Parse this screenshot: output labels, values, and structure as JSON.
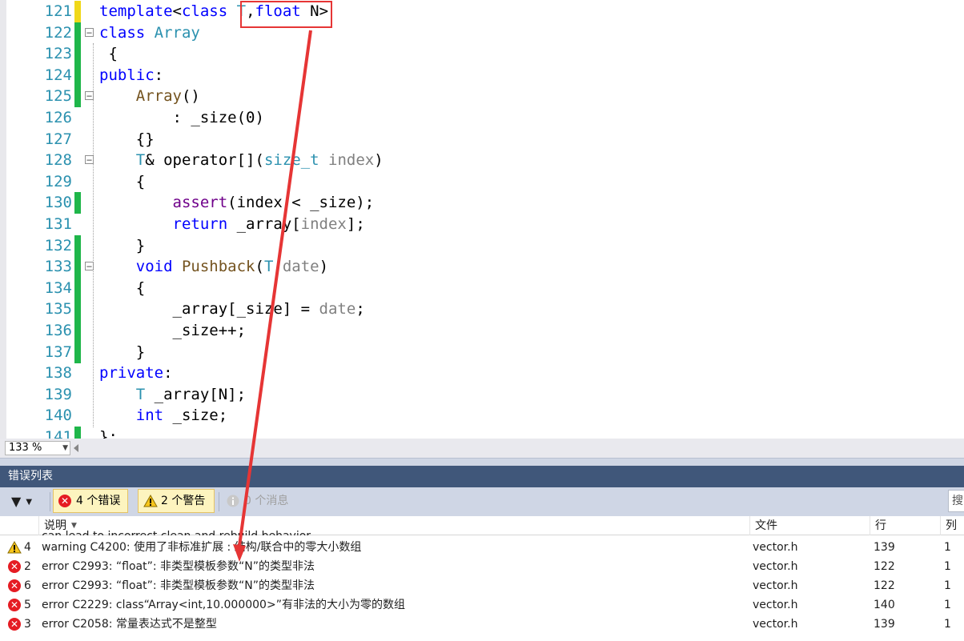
{
  "editor": {
    "lines": [
      {
        "num": "121",
        "mark": "yellow",
        "fold": "",
        "indent": 0,
        "tokens": [
          [
            "kw",
            "template"
          ],
          [
            "plain",
            "<"
          ],
          [
            "kw",
            "class"
          ],
          [
            "plain",
            " "
          ],
          [
            "ty",
            "T"
          ],
          [
            "plain",
            ","
          ],
          [
            "kw",
            "float"
          ],
          [
            "plain",
            " N>"
          ]
        ]
      },
      {
        "num": "122",
        "mark": "green",
        "fold": "-",
        "indent": 0,
        "tokens": [
          [
            "kw",
            "class"
          ],
          [
            "plain",
            " "
          ],
          [
            "ty",
            "Array"
          ]
        ]
      },
      {
        "num": "123",
        "mark": "green",
        "fold": "",
        "indent": 0,
        "tokens": [
          [
            "plain",
            " {"
          ]
        ]
      },
      {
        "num": "124",
        "mark": "green",
        "fold": "",
        "indent": 0,
        "tokens": [
          [
            "kw",
            "public"
          ],
          [
            "plain",
            ":"
          ]
        ]
      },
      {
        "num": "125",
        "mark": "green",
        "fold": "-",
        "indent": 0,
        "tokens": [
          [
            "plain",
            "    "
          ],
          [
            "fn",
            "Array"
          ],
          [
            "plain",
            "()"
          ]
        ]
      },
      {
        "num": "126",
        "mark": "",
        "fold": "",
        "indent": 0,
        "tokens": [
          [
            "plain",
            "        : _size(0)"
          ]
        ]
      },
      {
        "num": "127",
        "mark": "",
        "fold": "",
        "indent": 0,
        "tokens": [
          [
            "plain",
            "    {}"
          ]
        ]
      },
      {
        "num": "128",
        "mark": "",
        "fold": "-",
        "indent": 0,
        "tokens": [
          [
            "plain",
            "    "
          ],
          [
            "ty",
            "T"
          ],
          [
            "plain",
            "& operator[]("
          ],
          [
            "ty",
            "size_t"
          ],
          [
            "plain",
            " "
          ],
          [
            "par",
            "index"
          ],
          [
            "plain",
            ")"
          ]
        ]
      },
      {
        "num": "129",
        "mark": "",
        "fold": "",
        "indent": 0,
        "tokens": [
          [
            "plain",
            "    {"
          ]
        ]
      },
      {
        "num": "130",
        "mark": "green",
        "fold": "",
        "indent": 0,
        "tokens": [
          [
            "plain",
            "        "
          ],
          [
            "mac",
            "assert"
          ],
          [
            "plain",
            "(index < _size);"
          ]
        ]
      },
      {
        "num": "131",
        "mark": "",
        "fold": "",
        "indent": 0,
        "tokens": [
          [
            "plain",
            "        "
          ],
          [
            "kw",
            "return"
          ],
          [
            "plain",
            " _array["
          ],
          [
            "par",
            "index"
          ],
          [
            "plain",
            "];"
          ]
        ]
      },
      {
        "num": "132",
        "mark": "green",
        "fold": "",
        "indent": 0,
        "tokens": [
          [
            "plain",
            "    }"
          ]
        ]
      },
      {
        "num": "133",
        "mark": "green",
        "fold": "-",
        "indent": 0,
        "tokens": [
          [
            "plain",
            "    "
          ],
          [
            "kw",
            "void"
          ],
          [
            "plain",
            " "
          ],
          [
            "fn",
            "Pushback"
          ],
          [
            "plain",
            "("
          ],
          [
            "ty",
            "T"
          ],
          [
            "plain",
            " "
          ],
          [
            "par",
            "date"
          ],
          [
            "plain",
            ")"
          ]
        ]
      },
      {
        "num": "134",
        "mark": "green",
        "fold": "",
        "indent": 0,
        "tokens": [
          [
            "plain",
            "    {"
          ]
        ]
      },
      {
        "num": "135",
        "mark": "green",
        "fold": "",
        "indent": 0,
        "tokens": [
          [
            "plain",
            "        _array[_size] = "
          ],
          [
            "par",
            "date"
          ],
          [
            "plain",
            ";"
          ]
        ]
      },
      {
        "num": "136",
        "mark": "green",
        "fold": "",
        "indent": 0,
        "tokens": [
          [
            "plain",
            "        _size++;"
          ]
        ]
      },
      {
        "num": "137",
        "mark": "green",
        "fold": "",
        "indent": 0,
        "tokens": [
          [
            "plain",
            "    }"
          ]
        ]
      },
      {
        "num": "138",
        "mark": "",
        "fold": "",
        "indent": 0,
        "tokens": [
          [
            "kw",
            "private"
          ],
          [
            "plain",
            ":"
          ]
        ]
      },
      {
        "num": "139",
        "mark": "",
        "fold": "",
        "indent": 0,
        "tokens": [
          [
            "plain",
            "    "
          ],
          [
            "ty",
            "T"
          ],
          [
            "plain",
            " _array[N];"
          ]
        ]
      },
      {
        "num": "140",
        "mark": "",
        "fold": "",
        "indent": 0,
        "tokens": [
          [
            "plain",
            "    "
          ],
          [
            "kw",
            "int"
          ],
          [
            "plain",
            " _size;"
          ]
        ]
      },
      {
        "num": "141",
        "mark": "green",
        "fold": "",
        "indent": 0,
        "tokens": [
          [
            "plain",
            "};"
          ]
        ]
      }
    ]
  },
  "zoom": {
    "value": "133 %"
  },
  "error_list": {
    "title": "错误列表",
    "toolbar": {
      "errors_label": "4 个错误",
      "warnings_label": "2 个警告",
      "messages_label": "0 个消息",
      "search_placeholder": "搜"
    },
    "columns": {
      "description": "说明",
      "file": "文件",
      "line": "行",
      "column": "列"
    },
    "clipped_row_text": "can lead to incorrect clean and rebuild behavior",
    "rows": [
      {
        "severity": "warning",
        "index": "4",
        "description": "warning C4200: 使用了非标准扩展 : 结构/联合中的零大小数组",
        "file": "vector.h",
        "line": "139",
        "col": "1"
      },
      {
        "severity": "error",
        "index": "2",
        "description": "error C2993: “float”: 非类型模板参数“N”的类型非法",
        "file": "vector.h",
        "line": "122",
        "col": "1"
      },
      {
        "severity": "error",
        "index": "6",
        "description": "error C2993: “float”: 非类型模板参数“N”的类型非法",
        "file": "vector.h",
        "line": "122",
        "col": "1"
      },
      {
        "severity": "error",
        "index": "5",
        "description": "error C2229: class“Array<int,10.000000>”有非法的大小为零的数组",
        "file": "vector.h",
        "line": "140",
        "col": "1"
      },
      {
        "severity": "error",
        "index": "3",
        "description": "error C2058: 常量表达式不是整型",
        "file": "vector.h",
        "line": "139",
        "col": "1"
      }
    ]
  },
  "colors": {
    "annotation_red": "#e63535",
    "panel_title_bg": "#40577a",
    "toolbar_bg": "#cfd6e5"
  }
}
